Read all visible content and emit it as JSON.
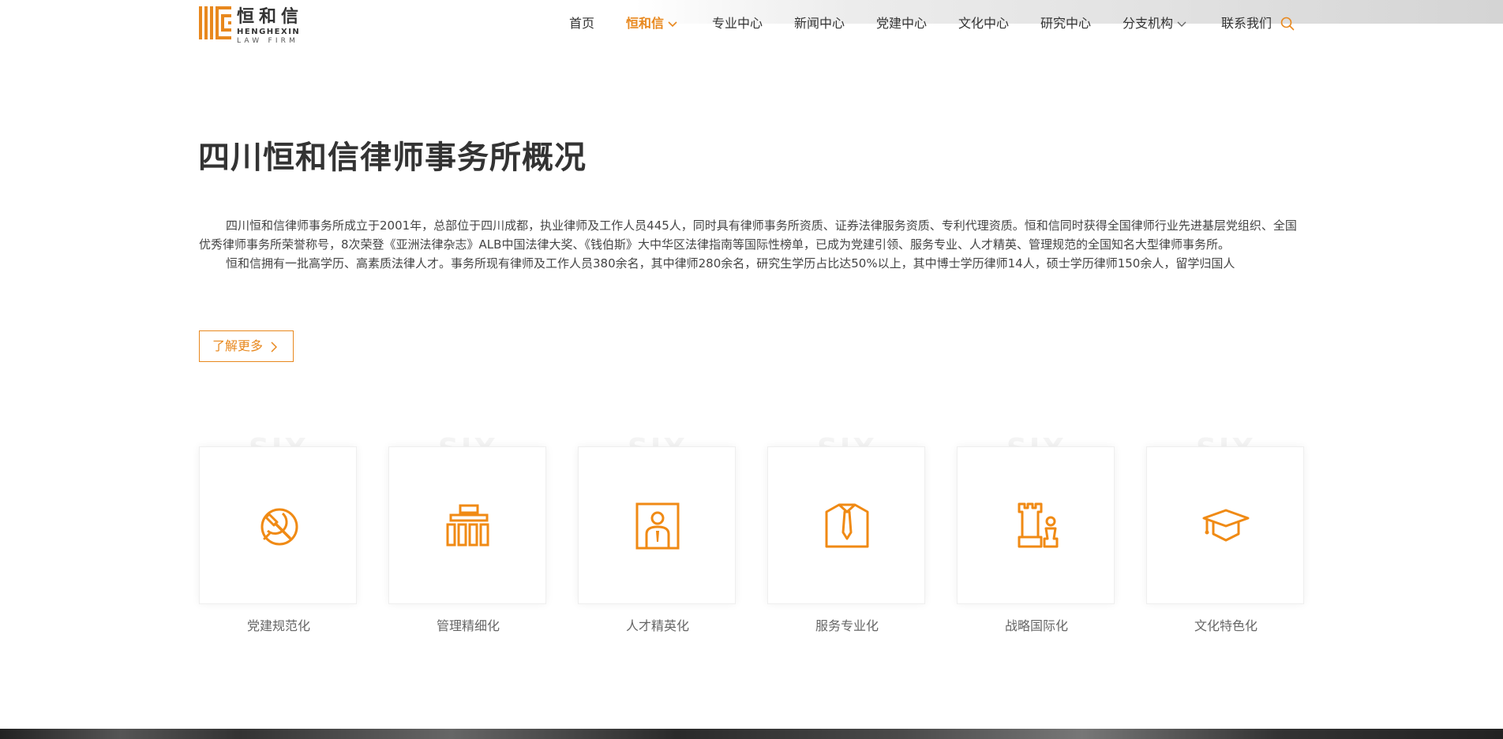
{
  "header": {
    "logo": {
      "cn": "恒和信",
      "en_line1": "HENGHEXIN",
      "en_line2": "LAW FIRM"
    },
    "nav": [
      {
        "label": "首页",
        "active": false,
        "has_dropdown": false
      },
      {
        "label": "恒和信",
        "active": true,
        "has_dropdown": true
      },
      {
        "label": "专业中心",
        "active": false,
        "has_dropdown": false
      },
      {
        "label": "新闻中心",
        "active": false,
        "has_dropdown": false
      },
      {
        "label": "党建中心",
        "active": false,
        "has_dropdown": false
      },
      {
        "label": "文化中心",
        "active": false,
        "has_dropdown": false
      },
      {
        "label": "研究中心",
        "active": false,
        "has_dropdown": false
      },
      {
        "label": "分支机构",
        "active": false,
        "has_dropdown": true
      },
      {
        "label": "联系我们",
        "active": false,
        "has_dropdown": false
      }
    ],
    "search_icon": "search-icon"
  },
  "main": {
    "title": "四川恒和信律师事务所概况",
    "paragraphs": [
      "四川恒和信律师事务所成立于2001年，总部位于四川成都，执业律师及工作人员445人，同时具有律师事务所资质、证券法律服务资质、专利代理资质。恒和信同时获得全国律师行业先进基层党组织、全国优秀律师事务所荣誉称号，8次荣登《亚洲法律杂志》ALB中国法律大奖、《钱伯斯》大中华区法律指南等国际性榜单，已成为党建引领、服务专业、人才精英、管理规范的全国知名大型律师事务所。",
      "恒和信拥有一批高学历、高素质法律人才。事务所现有律师及工作人员380余名，其中律师280余名，研究生学历占比达50%以上，其中博士学历律师14人，硕士学历律师150余人，留学归国人"
    ],
    "more_label": "了解更多"
  },
  "features": [
    {
      "watermark": "SIX",
      "label": "党建规范化",
      "icon": "party-emblem-icon"
    },
    {
      "watermark": "SIX",
      "label": "管理精细化",
      "icon": "org-chart-icon"
    },
    {
      "watermark": "SIX",
      "label": "人才精英化",
      "icon": "person-frame-icon"
    },
    {
      "watermark": "SIX",
      "label": "服务专业化",
      "icon": "shirt-tie-icon"
    },
    {
      "watermark": "SIX",
      "label": "战略国际化",
      "icon": "chess-icon"
    },
    {
      "watermark": "SIX",
      "label": "文化特色化",
      "icon": "graduation-cap-icon"
    }
  ],
  "colors": {
    "accent": "#e8881e",
    "text": "#333333",
    "muted": "#666666"
  }
}
